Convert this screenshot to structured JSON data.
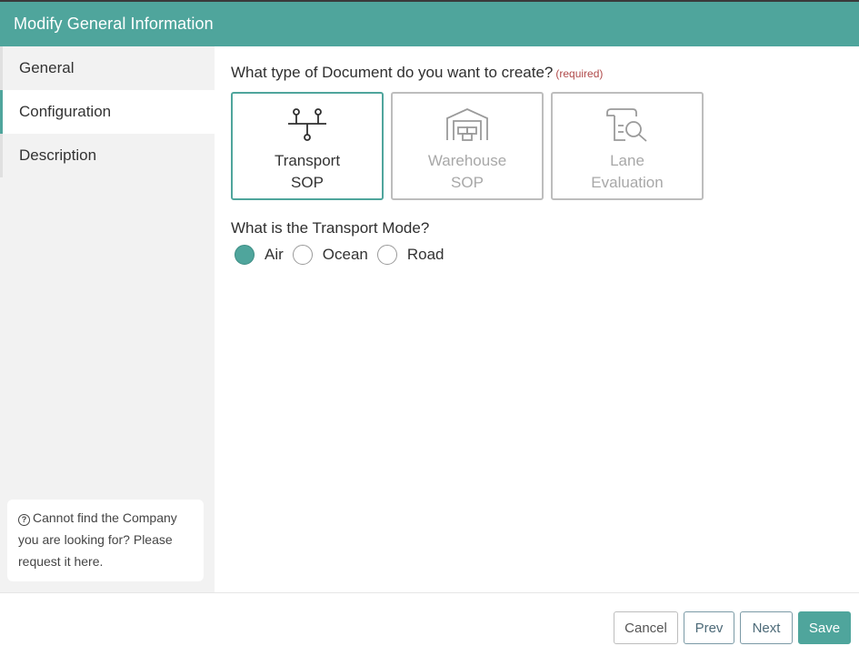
{
  "header": {
    "title": "Modify General Information"
  },
  "sidebar": {
    "items": [
      {
        "label": "General"
      },
      {
        "label": "Configuration"
      },
      {
        "label": "Description"
      }
    ],
    "help": {
      "text": "Cannot find the Company you are looking for? Please request it here."
    }
  },
  "main": {
    "document_question": "What type of Document do you want to create?",
    "required_label": "(required)",
    "cards": [
      {
        "line1": "Transport",
        "line2": "SOP",
        "icon": "transport-network-icon",
        "selected": true
      },
      {
        "line1": "Warehouse",
        "line2": "SOP",
        "icon": "warehouse-icon",
        "selected": false
      },
      {
        "line1": "Lane",
        "line2": "Evaluation",
        "icon": "document-search-icon",
        "selected": false
      }
    ],
    "mode_question": "What is the Transport Mode?",
    "modes": [
      {
        "label": "Air",
        "checked": true
      },
      {
        "label": "Ocean",
        "checked": false
      },
      {
        "label": "Road",
        "checked": false
      }
    ]
  },
  "footer": {
    "cancel": "Cancel",
    "prev": "Prev",
    "next": "Next",
    "save": "Save"
  },
  "colors": {
    "accent": "#4fa59c",
    "required": "#b04a4a"
  }
}
